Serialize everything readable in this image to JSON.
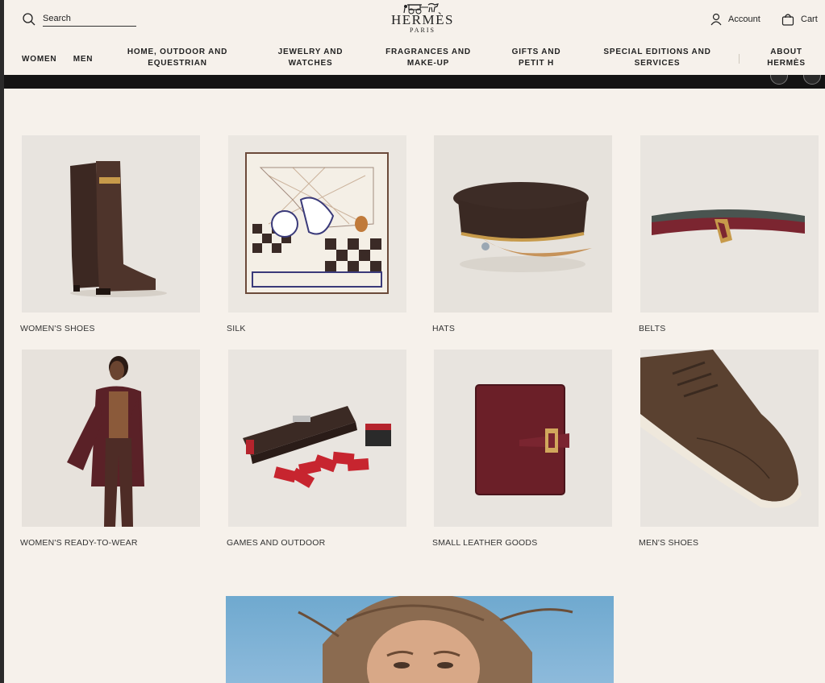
{
  "header": {
    "search_label": "Search",
    "logo_word": "HERMÈS",
    "logo_sub": "PARIS",
    "account_label": "Account",
    "cart_label": "Cart"
  },
  "nav": {
    "items": [
      {
        "line1": "WOMEN",
        "line2": ""
      },
      {
        "line1": "MEN",
        "line2": ""
      },
      {
        "line1": "HOME, OUTDOOR AND",
        "line2": "EQUESTRIAN"
      },
      {
        "line1": "JEWELRY AND",
        "line2": "WATCHES"
      },
      {
        "line1": "FRAGRANCES AND",
        "line2": "MAKE-UP"
      },
      {
        "line1": "GIFTS AND",
        "line2": "PETIT H"
      },
      {
        "line1": "SPECIAL EDITIONS AND",
        "line2": "SERVICES"
      },
      {
        "line1": "ABOUT",
        "line2": "HERMÈS"
      }
    ]
  },
  "categories": [
    {
      "label": "WOMEN'S SHOES",
      "icon": "boot-image"
    },
    {
      "label": "SILK",
      "icon": "scarf-image"
    },
    {
      "label": "HATS",
      "icon": "cap-image"
    },
    {
      "label": "BELTS",
      "icon": "belt-image"
    },
    {
      "label": "WOMEN'S READY-TO-WEAR",
      "icon": "model-image"
    },
    {
      "label": "GAMES AND OUTDOOR",
      "icon": "dominoes-image"
    },
    {
      "label": "SMALL LEATHER GOODS",
      "icon": "wallet-image"
    },
    {
      "label": "MEN'S SHOES",
      "icon": "shoe-image"
    }
  ],
  "colors": {
    "background": "#f6f1eb",
    "tile": "#e9e4dd",
    "leather_brown": "#4a3128",
    "burgundy": "#6e2328",
    "gold": "#c79a4a"
  }
}
